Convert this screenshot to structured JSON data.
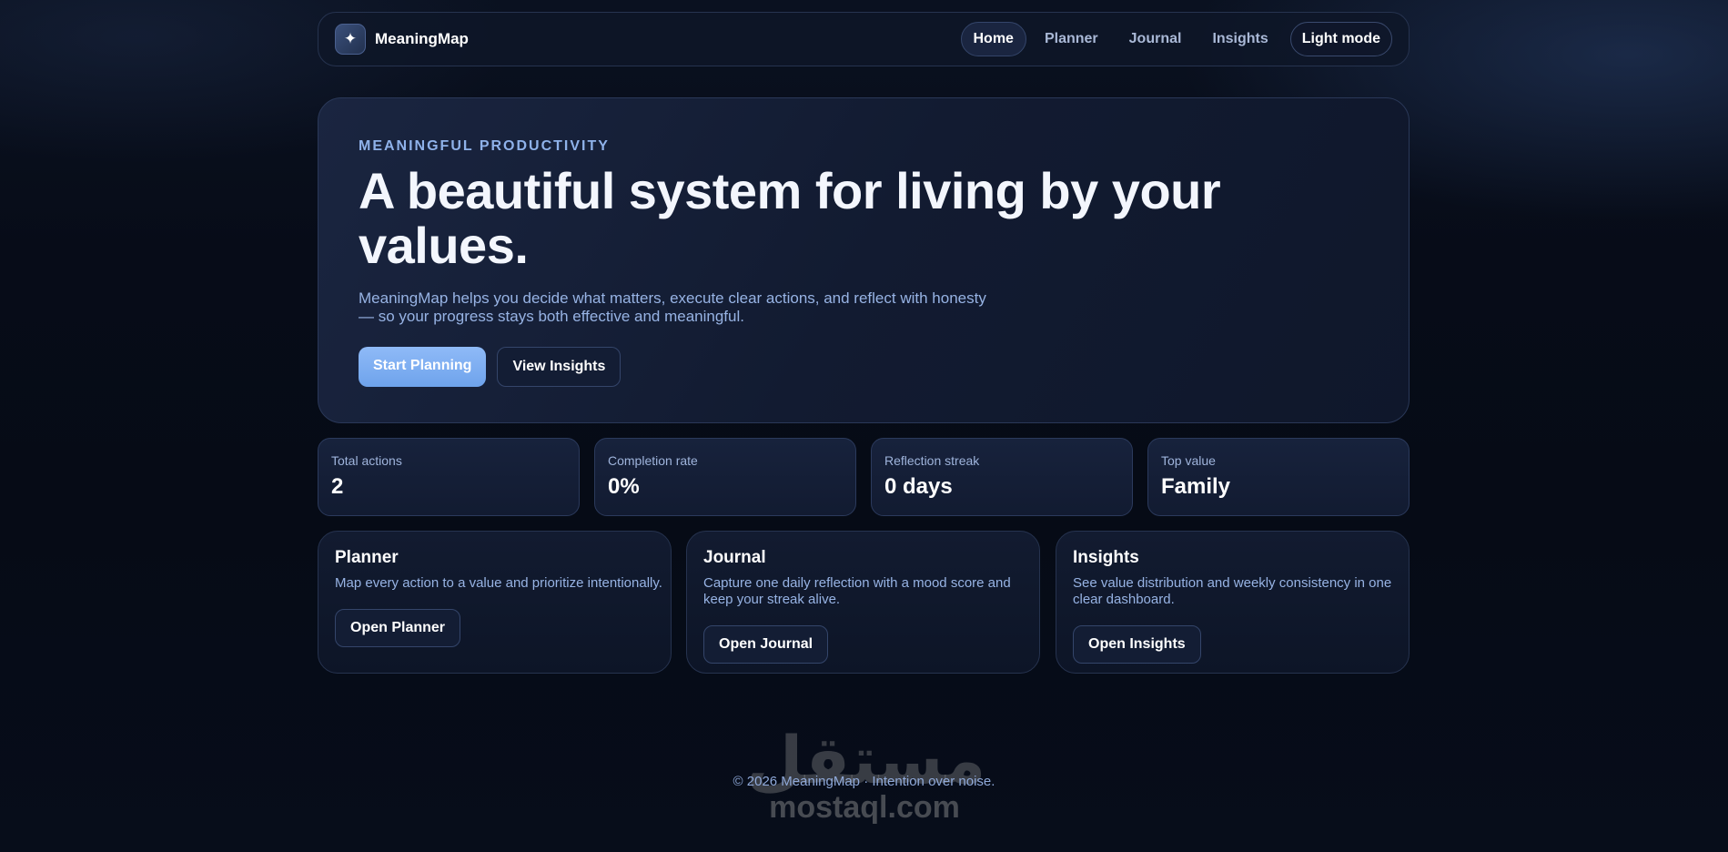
{
  "nav": {
    "brand": "MeaningMap",
    "logo_icon": "sparkle-icon",
    "links": [
      {
        "label": "Home",
        "active": true
      },
      {
        "label": "Planner",
        "active": false
      },
      {
        "label": "Journal",
        "active": false
      },
      {
        "label": "Insights",
        "active": false
      }
    ],
    "mode_toggle": "Light mode"
  },
  "hero": {
    "eyebrow": "MEANINGFUL PRODUCTIVITY",
    "title": "A beautiful system for living by your values.",
    "subtitle": "MeaningMap helps you decide what matters, execute clear actions, and reflect with honesty — so your progress stays both effective and meaningful.",
    "primary_cta": "Start Planning",
    "secondary_cta": "View Insights"
  },
  "stats": [
    {
      "label": "Total actions",
      "value": "2"
    },
    {
      "label": "Completion rate",
      "value": "0%"
    },
    {
      "label": "Reflection streak",
      "value": "0 days"
    },
    {
      "label": "Top value",
      "value": "Family"
    }
  ],
  "features": [
    {
      "title": "Planner",
      "description": "Map every action to a value and prioritize intentionally.",
      "button": "Open Planner"
    },
    {
      "title": "Journal",
      "description": "Capture one daily reflection with a mood score and keep your streak alive.",
      "button": "Open Journal"
    },
    {
      "title": "Insights",
      "description": "See value distribution and weekly consistency in one clear dashboard.",
      "button": "Open Insights"
    }
  ],
  "footer": "© 2026 MeaningMap · Intention over noise.",
  "watermark": {
    "arabic": "مستقل",
    "latin": "mostaql.com"
  },
  "colors": {
    "accent": "#7fb0f2",
    "background": "#070c18",
    "card": "#121b31",
    "border": "#2b3a5c"
  }
}
